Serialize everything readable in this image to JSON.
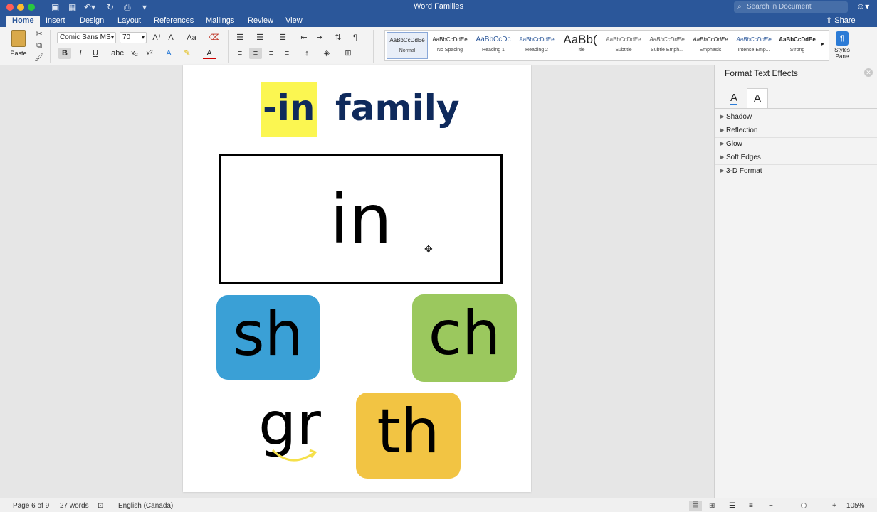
{
  "window": {
    "title": "Word Families",
    "search_placeholder": "Search in Document",
    "share": "Share"
  },
  "tabs": [
    "Home",
    "Insert",
    "Design",
    "Layout",
    "References",
    "Mailings",
    "Review",
    "View"
  ],
  "ribbon": {
    "paste": "Paste",
    "font_name": "Comic Sans MS",
    "font_size": "70",
    "styles": [
      {
        "preview": "AaBbCcDdEe",
        "name": "Normal"
      },
      {
        "preview": "AaBbCcDdEe",
        "name": "No Spacing"
      },
      {
        "preview": "AaBbCcDc",
        "name": "Heading 1"
      },
      {
        "preview": "AaBbCcDdEe",
        "name": "Heading 2"
      },
      {
        "preview": "AaBb(",
        "name": "Title"
      },
      {
        "preview": "AaBbCcDdEe",
        "name": "Subtitle"
      },
      {
        "preview": "AaBbCcDdEe",
        "name": "Subtle Emph..."
      },
      {
        "preview": "AaBbCcDdEe",
        "name": "Emphasis"
      },
      {
        "preview": "AaBbCcDdEe",
        "name": "Intense Emp..."
      },
      {
        "preview": "AaBbCcDdEe",
        "name": "Strong"
      }
    ],
    "styles_pane": "Styles Pane"
  },
  "document": {
    "heading_highlight": "-in",
    "heading_rest": "family",
    "box_word": "in",
    "tiles": {
      "sh": "sh",
      "ch": "ch",
      "gr": "gr",
      "th": "th"
    },
    "colors": {
      "sh": "#3aa0d6",
      "ch": "#9bc85e",
      "th": "#f2c443",
      "highlight": "#fbf651",
      "heading": "#0f2a5c"
    }
  },
  "panel": {
    "title": "Format Text Effects",
    "sections": [
      "Shadow",
      "Reflection",
      "Glow",
      "Soft Edges",
      "3-D Format"
    ]
  },
  "status": {
    "page": "Page 6 of 9",
    "words": "27 words",
    "language": "English (Canada)",
    "zoom": "105%"
  }
}
